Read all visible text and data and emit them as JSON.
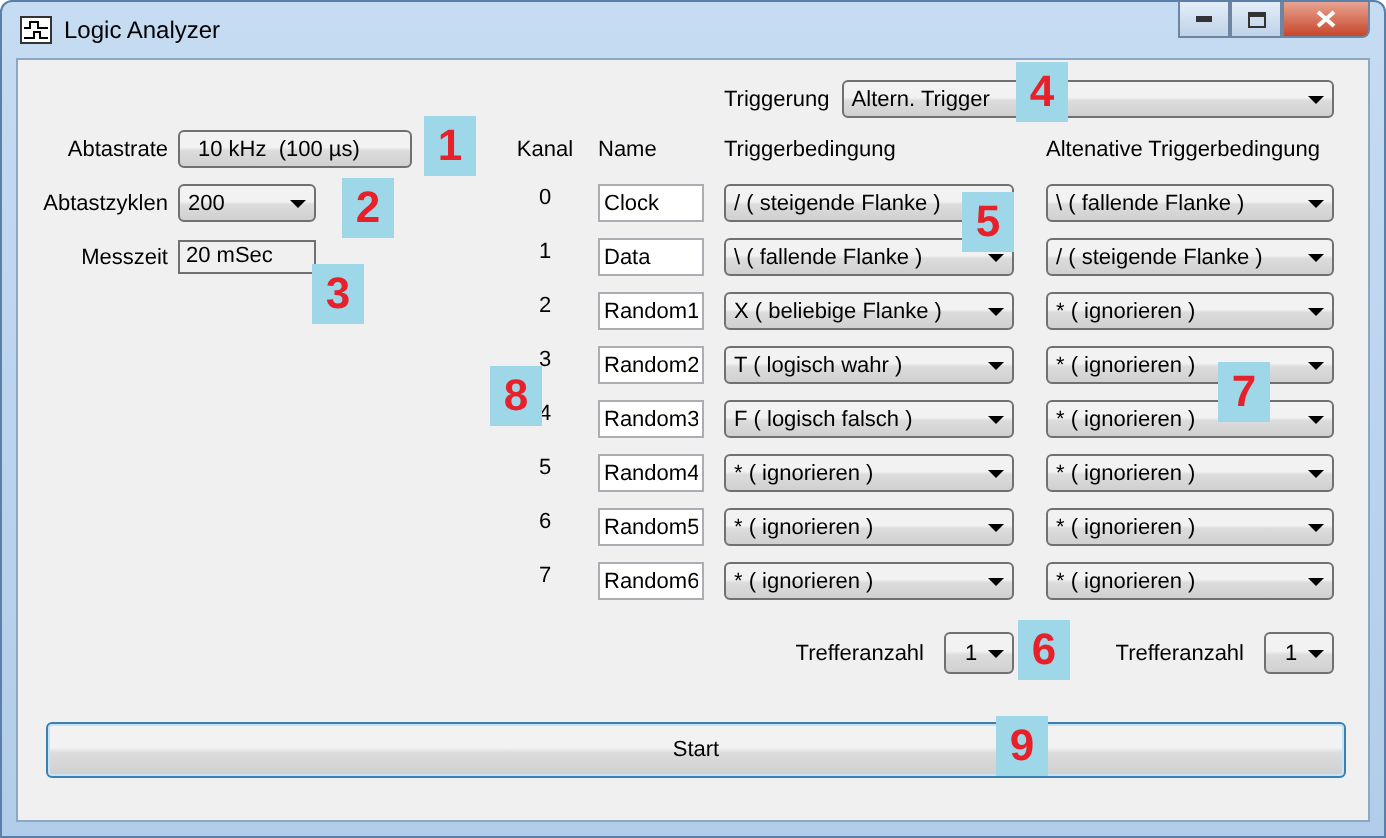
{
  "window": {
    "title": "Logic Analyzer"
  },
  "sampling": {
    "rate_label": "Abtastrate",
    "rate_button": "10 kHz  (100 µs)",
    "cycles_label": "Abtastzyklen",
    "cycles": "200",
    "time_label": "Messzeit",
    "time": "20 mSec"
  },
  "triggering": {
    "label": "Triggerung",
    "value": "Altern. Trigger"
  },
  "columns": [
    "Kanal",
    "Name",
    "Triggerbedingung",
    "Altenative Triggerbedingung"
  ],
  "channels": [
    {
      "index": "0",
      "name": "Clock",
      "condition": "/ ( steigende Flanke )",
      "alt_condition": "\\ ( fallende Flanke )"
    },
    {
      "index": "1",
      "name": "Data",
      "condition": "\\ ( fallende Flanke )",
      "alt_condition": "/ ( steigende Flanke )"
    },
    {
      "index": "2",
      "name": "Random1",
      "condition": "X ( beliebige Flanke )",
      "alt_condition": "* ( ignorieren )"
    },
    {
      "index": "3",
      "name": "Random2",
      "condition": "T ( logisch wahr )",
      "alt_condition": "* ( ignorieren )"
    },
    {
      "index": "4",
      "name": "Random3",
      "condition": "F ( logisch falsch )",
      "alt_condition": "* ( ignorieren )"
    },
    {
      "index": "5",
      "name": "Random4",
      "condition": "* ( ignorieren )",
      "alt_condition": "* ( ignorieren )"
    },
    {
      "index": "6",
      "name": "Random5",
      "condition": "* ( ignorieren )",
      "alt_condition": "* ( ignorieren )"
    },
    {
      "index": "7",
      "name": "Random6",
      "condition": "* ( ignorieren )",
      "alt_condition": "* ( ignorieren )"
    }
  ],
  "hits": [
    {
      "label": "Trefferanzahl",
      "value": "1"
    },
    {
      "label": "Trefferanzahl",
      "value": "1"
    }
  ],
  "start_button": "Start",
  "callouts": [
    "1",
    "2",
    "3",
    "4",
    "5",
    "6",
    "7",
    "8",
    "9"
  ]
}
